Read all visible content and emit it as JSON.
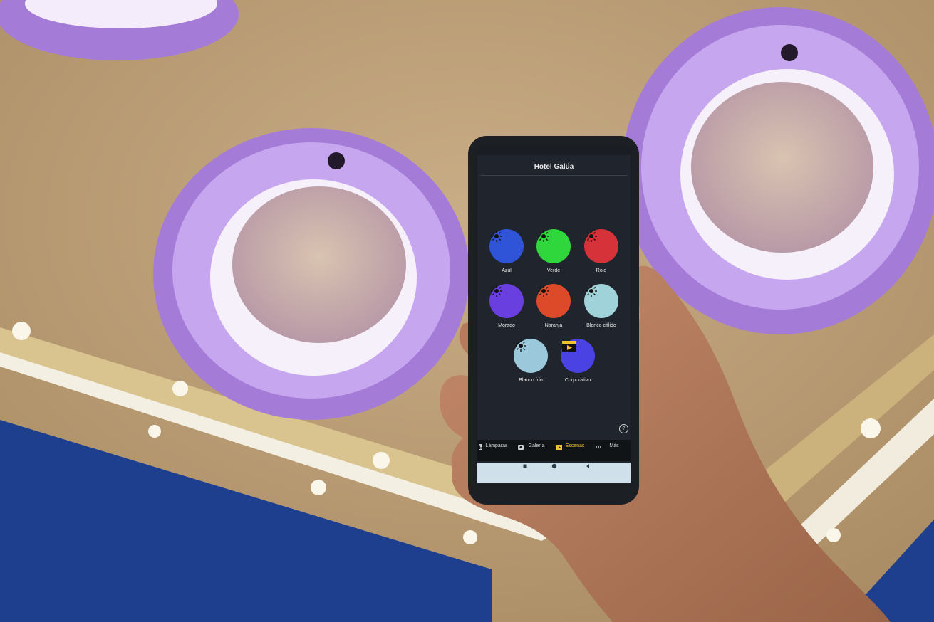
{
  "app": {
    "title": "Hotel Galúa",
    "scenes": [
      {
        "label": "Azul",
        "color": "#2f54d8",
        "icon": "sun-icon"
      },
      {
        "label": "Verde",
        "color": "#2fd63c",
        "icon": "sun-icon"
      },
      {
        "label": "Rojo",
        "color": "#d6323a",
        "icon": "sun-icon"
      },
      {
        "label": "Morado",
        "color": "#6a3fe0",
        "icon": "sun-icon"
      },
      {
        "label": "Naranja",
        "color": "#dc4a2a",
        "icon": "sun-icon"
      },
      {
        "label": "Blanco cálido",
        "color": "#9fd2d9",
        "icon": "sun-icon"
      },
      {
        "label": "Blanco frío",
        "color": "#9cc8dc",
        "icon": "sun-icon"
      },
      {
        "label": "Corporativo",
        "color": "#4a42e2",
        "icon": "clapperboard-icon"
      }
    ],
    "help_icon": "?",
    "tabs": [
      {
        "label": "Lámparas",
        "icon": "lamp-icon",
        "active": false
      },
      {
        "label": "Galería",
        "icon": "gallery-icon",
        "active": false
      },
      {
        "label": "Escenas",
        "icon": "clapperboard-icon",
        "active": true
      },
      {
        "label": "Más",
        "icon": "more-icon",
        "active": false
      }
    ],
    "accent_color": "#f2c230",
    "android_nav": [
      "square-icon",
      "circle-icon",
      "back-triangle-icon"
    ]
  }
}
